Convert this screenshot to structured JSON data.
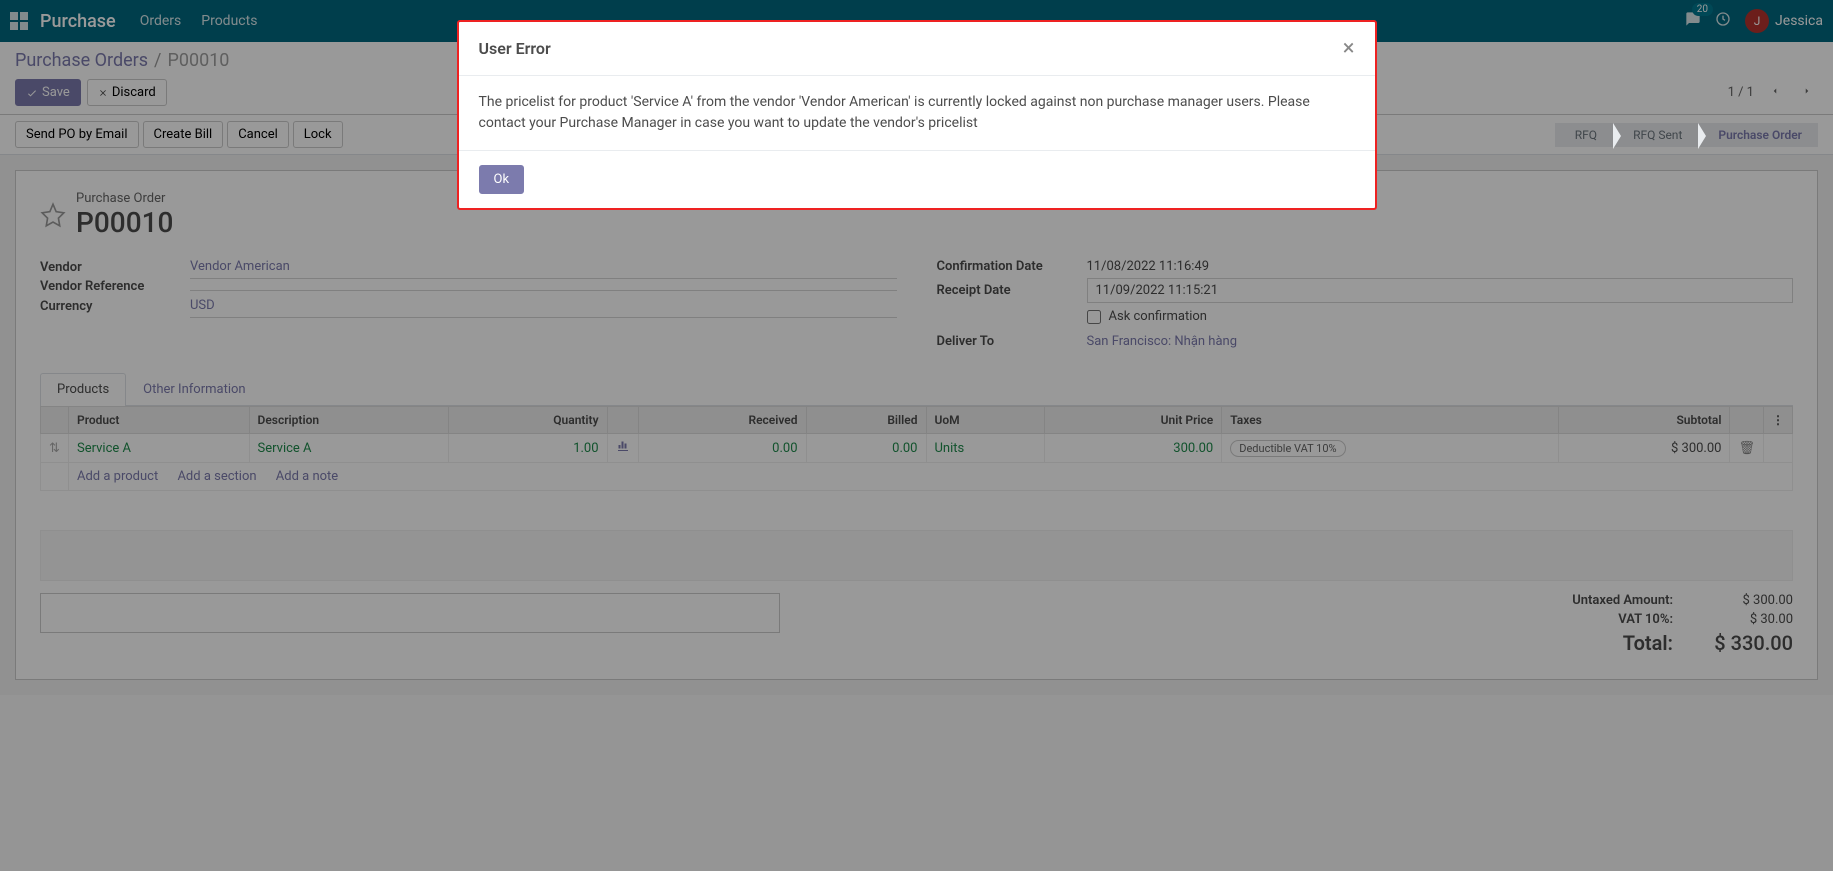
{
  "nav": {
    "brand": "Purchase",
    "links": [
      "Orders",
      "Products"
    ],
    "msg_count": "20",
    "user_initial": "J",
    "user_name": "Jessica"
  },
  "breadcrumb": {
    "root": "Purchase Orders",
    "current": "P00010"
  },
  "buttons": {
    "save": "Save",
    "discard": "Discard",
    "send_po": "Send PO by Email",
    "create_bill": "Create Bill",
    "cancel": "Cancel",
    "lock": "Lock"
  },
  "pager": {
    "text": "1 / 1"
  },
  "status": {
    "rfq": "RFQ",
    "rfq_sent": "RFQ Sent",
    "po": "Purchase Order"
  },
  "form": {
    "title_label": "Purchase Order",
    "title": "P00010",
    "vendor_label": "Vendor",
    "vendor": "Vendor American",
    "vendor_ref_label": "Vendor Reference",
    "vendor_ref": "",
    "currency_label": "Currency",
    "currency": "USD",
    "confirm_date_label": "Confirmation Date",
    "confirm_date": "11/08/2022 11:16:49",
    "receipt_date_label": "Receipt Date",
    "receipt_date": "11/09/2022 11:15:21",
    "ask_conf_label": "Ask confirmation",
    "deliver_to_label": "Deliver To",
    "deliver_to": "San Francisco: Nhận hàng"
  },
  "tabs": {
    "products": "Products",
    "other": "Other Information"
  },
  "table": {
    "headers": {
      "product": "Product",
      "description": "Description",
      "quantity": "Quantity",
      "received": "Received",
      "billed": "Billed",
      "uom": "UoM",
      "unit_price": "Unit Price",
      "taxes": "Taxes",
      "subtotal": "Subtotal"
    },
    "row": {
      "product": "Service A",
      "description": "Service A",
      "quantity": "1.00",
      "received": "0.00",
      "billed": "0.00",
      "uom": "Units",
      "unit_price": "300.00",
      "tax": "Deductible VAT 10%",
      "subtotal": "$ 300.00"
    },
    "add_product": "Add a product",
    "add_section": "Add a section",
    "add_note": "Add a note"
  },
  "totals": {
    "untaxed_label": "Untaxed Amount:",
    "untaxed": "$ 300.00",
    "vat_label": "VAT 10%:",
    "vat": "$ 30.00",
    "total_label": "Total:",
    "total": "$ 330.00"
  },
  "modal": {
    "title": "User Error",
    "body": "The pricelist for product 'Service A' from the vendor 'Vendor American' is currently locked against non purchase manager users. Please contact your Purchase Manager in case you want to update the vendor's pricelist",
    "ok": "Ok"
  }
}
